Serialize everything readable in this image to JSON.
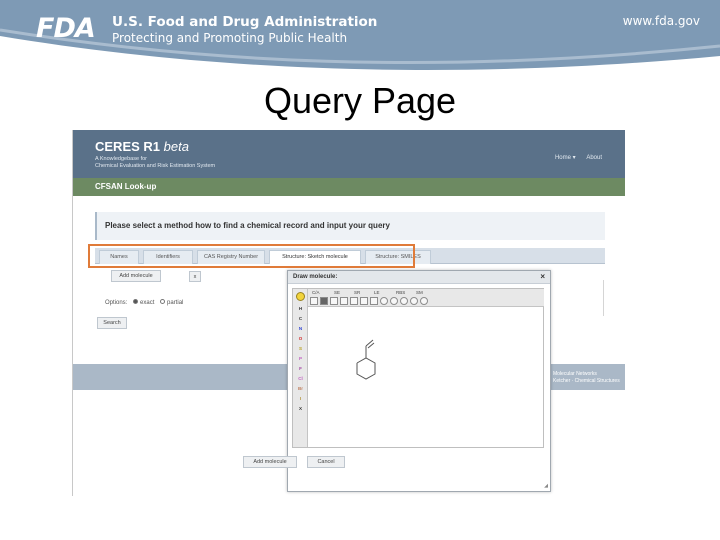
{
  "fda_header": {
    "logo_text": "FDA",
    "agency_name": "U.S. Food and Drug Administration",
    "tagline": "Protecting and Promoting Public Health",
    "website": "www.fda.gov"
  },
  "slide_title": "Query Page",
  "ceres": {
    "app_title": "CERES R1",
    "app_title_suffix": "beta",
    "subtitle_line1": "A Knowledgebase for",
    "subtitle_line2": "Chemical Evaluation and Risk Estimation System",
    "nav": {
      "home": "Home ▾",
      "about": "About"
    },
    "section_title": "CFSAN Look-up",
    "prompt": "Please select a method how to find a chemical record and input your query",
    "tabs": [
      {
        "label": "Names"
      },
      {
        "label": "Identifiers"
      },
      {
        "label": "CAS Registry Number"
      },
      {
        "label": "Structure: Sketch molecule"
      },
      {
        "label": "Structure: SMILES"
      }
    ],
    "active_tab_index": 3,
    "add_molecule_button": "Add molecule",
    "clear_button": "x",
    "options_label": "Options:",
    "option_exact": "exact",
    "option_partial": "partial",
    "selected_option": "exact",
    "search_button": "Search",
    "footer_brand_line1": "Molecular Networks",
    "footer_brand_line2": "Ketcher · Chemical Structures"
  },
  "dialog": {
    "title": "Draw molecule:",
    "close_label": "×",
    "toolbar_labels": [
      "C/A",
      "SE",
      "SR",
      "LE",
      "RBS",
      "SM"
    ],
    "element_buttons": [
      "H",
      "C",
      "N",
      "O",
      "S",
      "P",
      "F",
      "Cl",
      "Br",
      "I",
      "X"
    ],
    "add_molecule_button": "Add molecule",
    "cancel_button": "Cancel"
  }
}
